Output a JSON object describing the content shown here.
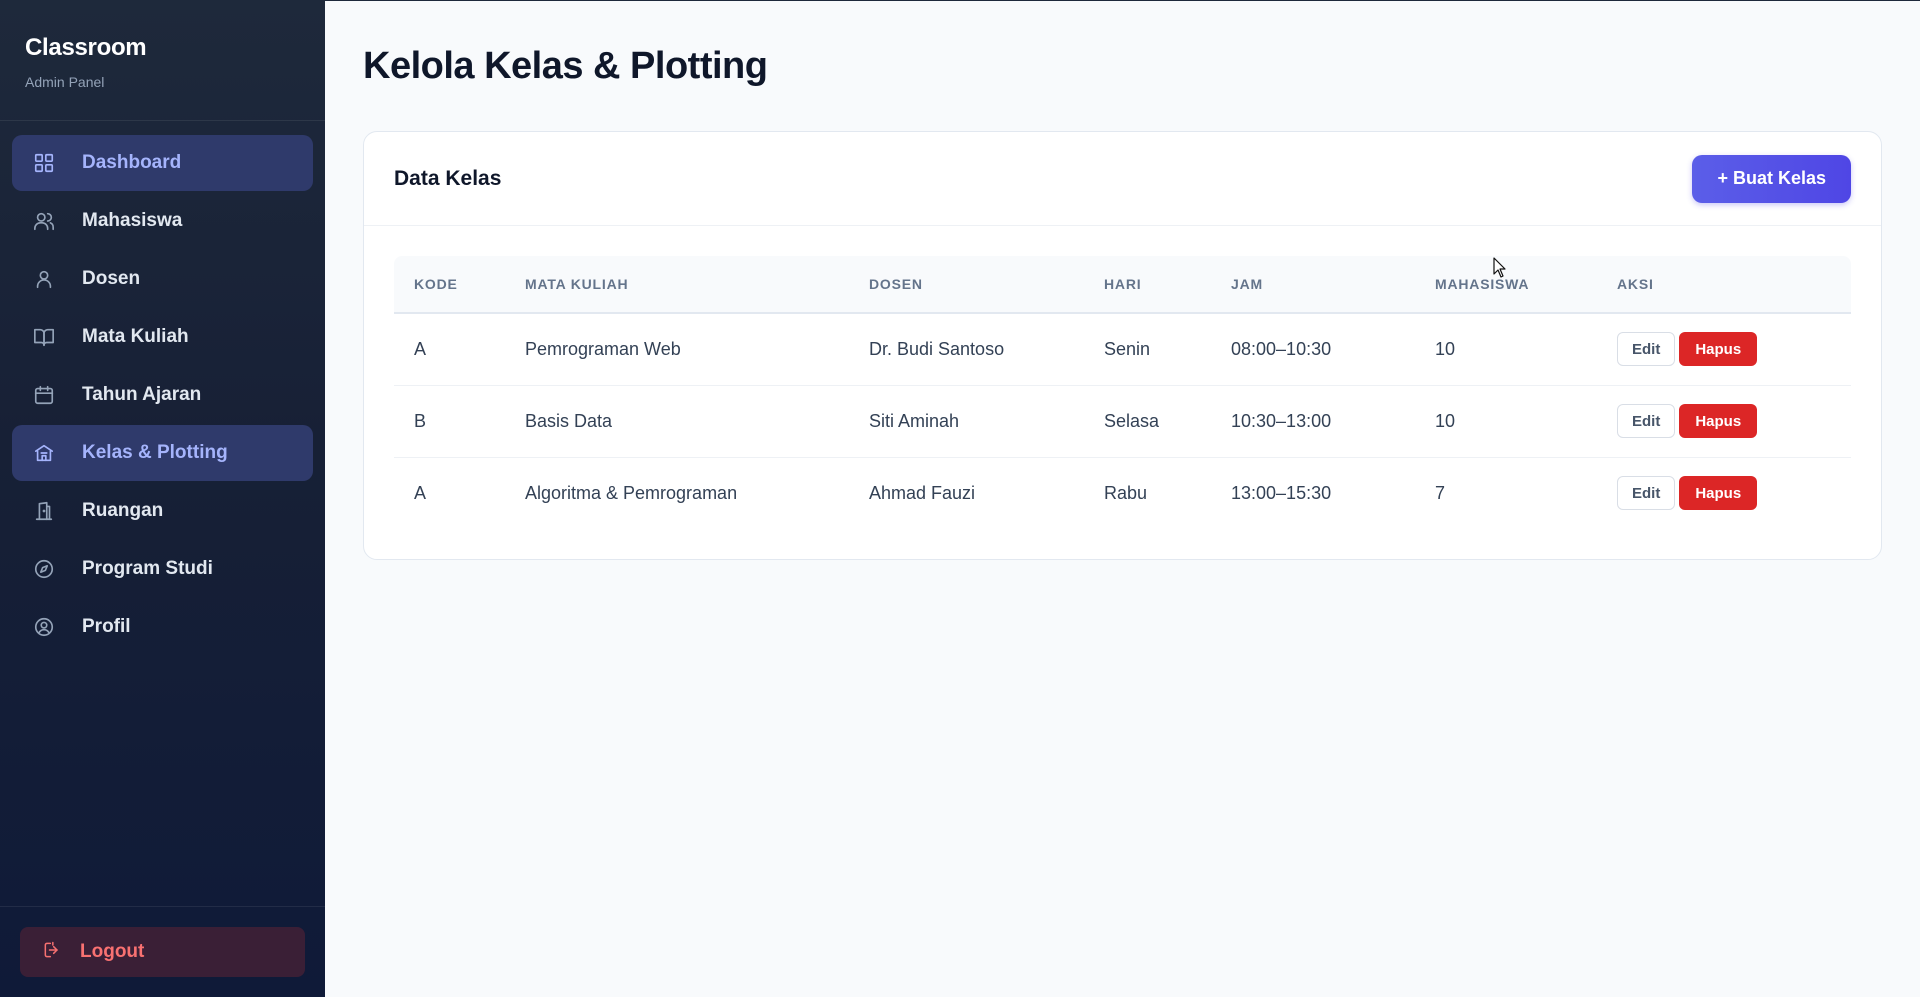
{
  "sidebar": {
    "brand_title": "Classroom",
    "brand_subtitle": "Admin Panel",
    "items": [
      {
        "label": "Dashboard",
        "icon": "grid-icon",
        "active": true
      },
      {
        "label": "Mahasiswa",
        "icon": "users-icon",
        "active": false
      },
      {
        "label": "Dosen",
        "icon": "user-icon",
        "active": false
      },
      {
        "label": "Mata Kuliah",
        "icon": "book-icon",
        "active": false
      },
      {
        "label": "Tahun Ajaran",
        "icon": "calendar-icon",
        "active": false
      },
      {
        "label": "Kelas & Plotting",
        "icon": "building-icon",
        "active": true
      },
      {
        "label": "Ruangan",
        "icon": "door-icon",
        "active": false
      },
      {
        "label": "Program Studi",
        "icon": "compass-icon",
        "active": false
      },
      {
        "label": "Profil",
        "icon": "user-circle-icon",
        "active": false
      }
    ],
    "logout_label": "Logout"
  },
  "main": {
    "page_title": "Kelola Kelas & Plotting",
    "card_title": "Data Kelas",
    "create_button": "+ Buat Kelas",
    "table": {
      "columns": [
        "KODE",
        "MATA KULIAH",
        "DOSEN",
        "HARI",
        "JAM",
        "MAHASISWA",
        "AKSI"
      ],
      "rows": [
        {
          "kode": "A",
          "mata_kuliah": "Pemrograman Web",
          "dosen": "Dr. Budi Santoso",
          "hari": "Senin",
          "jam": "08:00–10:30",
          "mahasiswa": "10"
        },
        {
          "kode": "B",
          "mata_kuliah": "Basis Data",
          "dosen": "Siti Aminah",
          "hari": "Selasa",
          "jam": "10:30–13:00",
          "mahasiswa": "10"
        },
        {
          "kode": "A",
          "mata_kuliah": "Algoritma & Pemrograman",
          "dosen": "Ahmad Fauzi",
          "hari": "Rabu",
          "jam": "13:00–15:30",
          "mahasiswa": "7"
        }
      ],
      "edit_label": "Edit",
      "delete_label": "Hapus"
    }
  },
  "colors": {
    "accent": "#4f46e5",
    "danger": "#dc2626",
    "sidebar_bg": "#1e293b",
    "active_text": "#a5b4fc"
  }
}
